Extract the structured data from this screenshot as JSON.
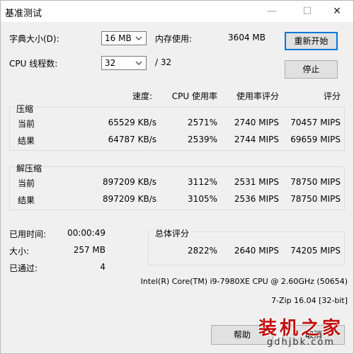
{
  "window": {
    "title": "基准测试",
    "controls": {
      "minimize": "—",
      "maximize": "☐",
      "close": "✕"
    }
  },
  "settings": {
    "dict_label": "字典大小(D):",
    "dict_value": "16 MB",
    "mem_label": "内存使用:",
    "mem_value": "3604 MB",
    "threads_label": "CPU 线程数:",
    "threads_value": "32",
    "threads_max": "/ 32"
  },
  "buttons": {
    "restart": "重新开始",
    "stop": "停止",
    "help": "帮助",
    "cancel": "取消"
  },
  "headers": {
    "speed": "速度:",
    "cpu_usage": "CPU 使用率",
    "usage_rating": "使用率评分",
    "rating": "评分"
  },
  "compress": {
    "title": "压缩",
    "rows": [
      {
        "label": "当前",
        "speed": "65529 KB/s",
        "cpu": "2571%",
        "usage_rating": "2740 MIPS",
        "rating": "70457 MIPS"
      },
      {
        "label": "结果",
        "speed": "64787 KB/s",
        "cpu": "2539%",
        "usage_rating": "2744 MIPS",
        "rating": "69659 MIPS"
      }
    ]
  },
  "decompress": {
    "title": "解压缩",
    "rows": [
      {
        "label": "当前",
        "speed": "897209 KB/s",
        "cpu": "3112%",
        "usage_rating": "2531 MIPS",
        "rating": "78750 MIPS"
      },
      {
        "label": "结果",
        "speed": "897209 KB/s",
        "cpu": "3105%",
        "usage_rating": "2536 MIPS",
        "rating": "78750 MIPS"
      }
    ]
  },
  "stats": {
    "elapsed_label": "已用时间:",
    "elapsed_value": "00:00:49",
    "size_label": "大小:",
    "size_value": "257 MB",
    "passes_label": "已通过:",
    "passes_value": "4"
  },
  "total": {
    "title": "总体评分",
    "cpu": "2822%",
    "usage_rating": "2640 MIPS",
    "rating": "74205 MIPS"
  },
  "cpu_info": "Intel(R) Core(TM) i9-7980XE CPU @ 2.60GHz (50654)",
  "version": "7-Zip 16.04 [32-bit]",
  "watermark": {
    "text": "装机之家",
    "url": "gdhjbk.com",
    "color": "#c01010"
  }
}
